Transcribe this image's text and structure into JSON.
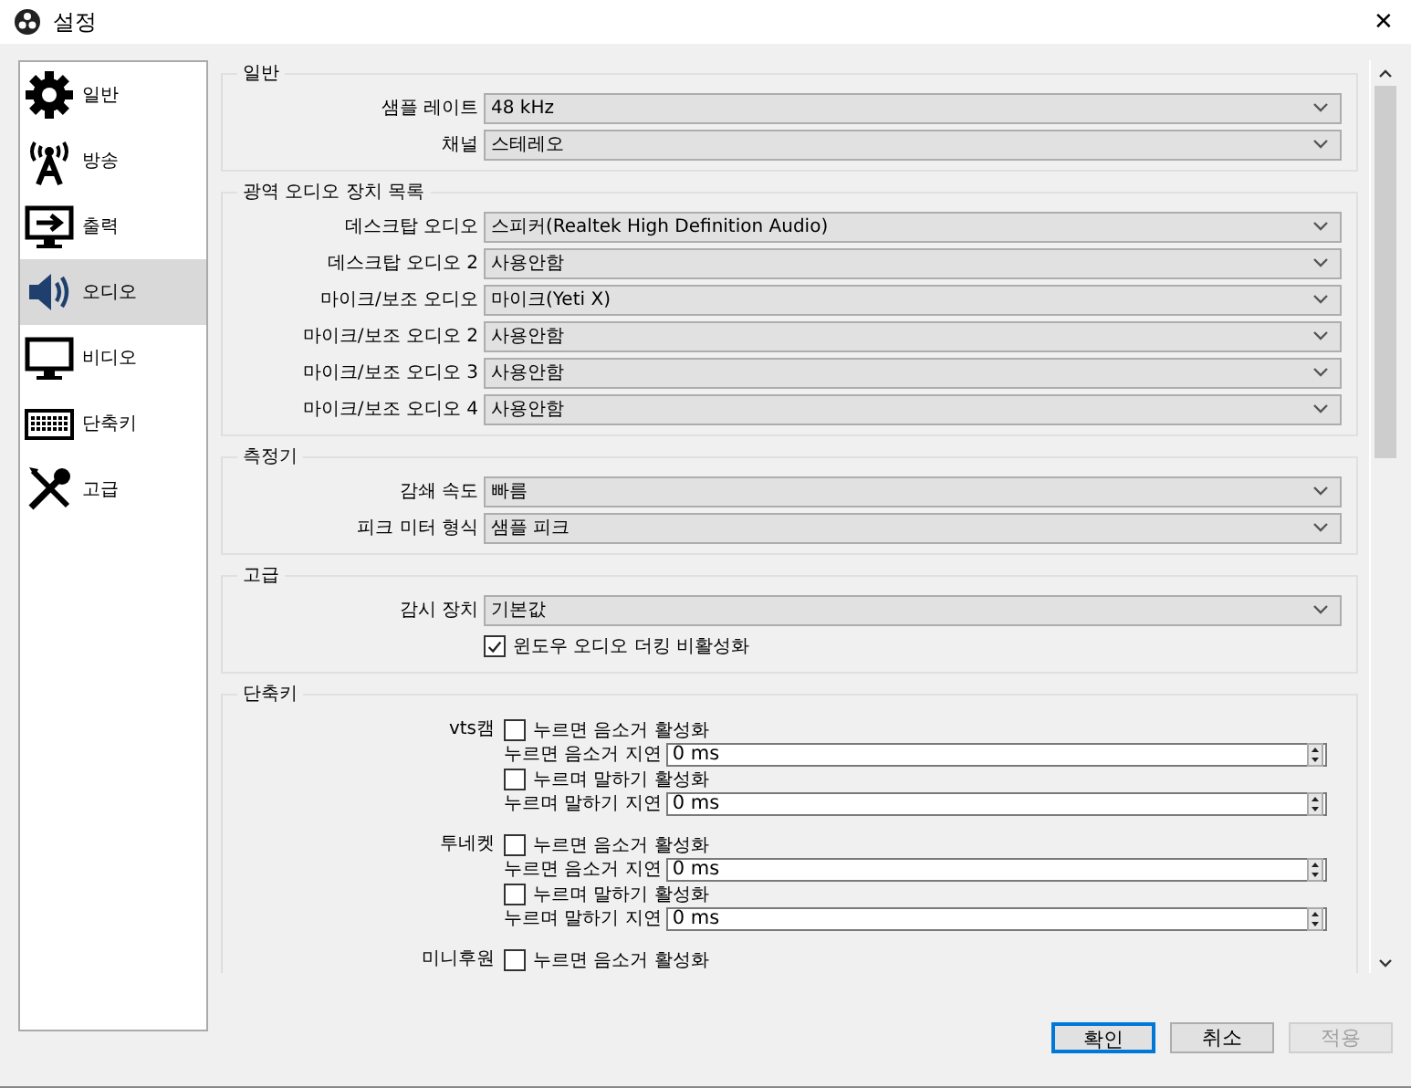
{
  "window": {
    "title": "설정",
    "close": "✕"
  },
  "sidebar": {
    "items": [
      {
        "label": "일반",
        "selected": false
      },
      {
        "label": "방송",
        "selected": false
      },
      {
        "label": "출력",
        "selected": false
      },
      {
        "label": "오디오",
        "selected": true
      },
      {
        "label": "비디오",
        "selected": false
      },
      {
        "label": "단축키",
        "selected": false
      },
      {
        "label": "고급",
        "selected": false
      }
    ]
  },
  "sections": [
    {
      "title": "일반",
      "rows": [
        {
          "kind": "select",
          "label": "샘플 레이트",
          "value": "48 kHz"
        },
        {
          "kind": "select",
          "label": "채널",
          "value": "스테레오"
        }
      ]
    },
    {
      "title": "광역 오디오 장치 목록",
      "rows": [
        {
          "kind": "select",
          "label": "데스크탑 오디오",
          "value": "스피커(Realtek High Definition Audio)"
        },
        {
          "kind": "select",
          "label": "데스크탑 오디오 2",
          "value": "사용안함"
        },
        {
          "kind": "select",
          "label": "마이크/보조 오디오",
          "value": "마이크(Yeti X)"
        },
        {
          "kind": "select",
          "label": "마이크/보조 오디오 2",
          "value": "사용안함"
        },
        {
          "kind": "select",
          "label": "마이크/보조 오디오 3",
          "value": "사용안함"
        },
        {
          "kind": "select",
          "label": "마이크/보조 오디오 4",
          "value": "사용안함"
        }
      ]
    },
    {
      "title": "측정기",
      "rows": [
        {
          "kind": "select",
          "label": "감쇄 속도",
          "value": "빠름"
        },
        {
          "kind": "select",
          "label": "피크 미터 형식",
          "value": "샘플 피크"
        }
      ]
    },
    {
      "title": "고급",
      "rows": [
        {
          "kind": "select",
          "label": "감시 장치",
          "value": "기본값"
        },
        {
          "kind": "checkbox",
          "label": "윈도우 오디오 더킹 비활성화",
          "checked": true
        }
      ]
    }
  ],
  "hotkeys": {
    "title": "단축키",
    "groups": [
      {
        "name": "vts캠",
        "items": [
          {
            "kind": "checkbox",
            "label": "누르면 음소거 활성화",
            "checked": false
          },
          {
            "kind": "spin",
            "label": "누르면 음소거 지연",
            "value": "0 ms"
          },
          {
            "kind": "checkbox",
            "label": "누르며 말하기 활성화",
            "checked": false
          },
          {
            "kind": "spin",
            "label": "누르며 말하기 지연",
            "value": "0 ms"
          }
        ]
      },
      {
        "name": "투네켓",
        "items": [
          {
            "kind": "checkbox",
            "label": "누르면 음소거 활성화",
            "checked": false
          },
          {
            "kind": "spin",
            "label": "누르면 음소거 지연",
            "value": "0 ms"
          },
          {
            "kind": "checkbox",
            "label": "누르며 말하기 활성화",
            "checked": false
          },
          {
            "kind": "spin",
            "label": "누르며 말하기 지연",
            "value": "0 ms"
          }
        ]
      },
      {
        "name": "미니후원",
        "items": [
          {
            "kind": "checkbox",
            "label": "누르면 음소거 활성화",
            "checked": false
          }
        ]
      }
    ]
  },
  "buttons": [
    {
      "label": "확인",
      "kind": "default",
      "disabled": false
    },
    {
      "label": "취소",
      "kind": "normal",
      "disabled": false
    },
    {
      "label": "적용",
      "kind": "normal",
      "disabled": true
    }
  ]
}
